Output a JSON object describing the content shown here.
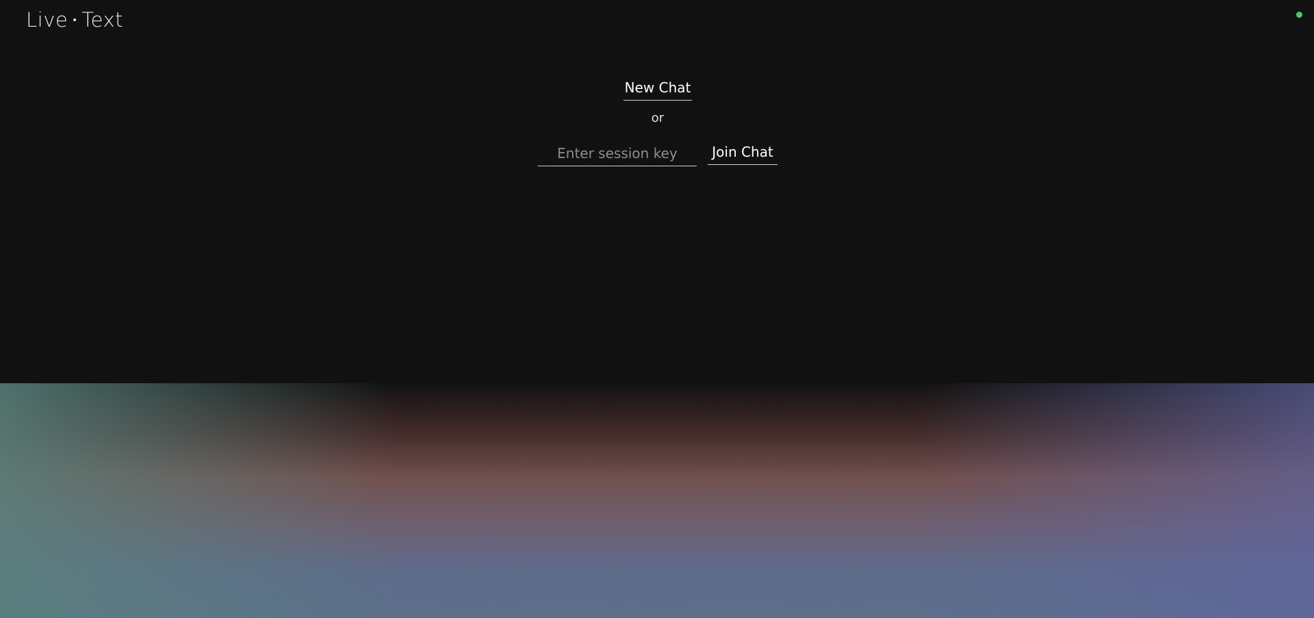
{
  "header": {
    "logo_left": "Live",
    "logo_right": "Text"
  },
  "status": {
    "indicator_color": "#4cc76a"
  },
  "main": {
    "new_chat_label": "New Chat",
    "separator_text": "or",
    "session_input_placeholder": "Enter session key",
    "session_input_value": "",
    "join_chat_label": "Join Chat"
  },
  "colors": {
    "background": "#111111",
    "text": "#ffffff",
    "accent_green": "#4cc76a"
  }
}
